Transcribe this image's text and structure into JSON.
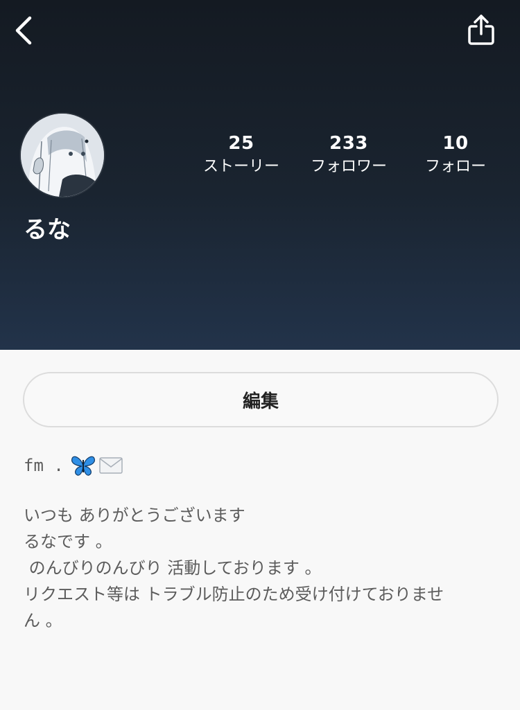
{
  "header": {
    "back_icon": "chevron-left-icon",
    "share_icon": "share-icon",
    "gradient_top": "#141a22",
    "gradient_bottom": "#22334a"
  },
  "profile": {
    "username": "るな",
    "stats": [
      {
        "count": "25",
        "label": "ストーリー"
      },
      {
        "count": "233",
        "label": "フォロワー"
      },
      {
        "count": "10",
        "label": "フォロー"
      }
    ]
  },
  "edit_button": {
    "label": "編集"
  },
  "bio": {
    "title": "fm .",
    "title_emojis": [
      "butterfly-icon",
      "envelope-icon"
    ],
    "lines": [
      "いつも ありがとうございます",
      "るなです 。",
      "",
      " のんびりのんびり 活動しております 。",
      "",
      "リクエスト等は トラブル防止のため受け付けておりませ",
      "ん 。"
    ]
  }
}
